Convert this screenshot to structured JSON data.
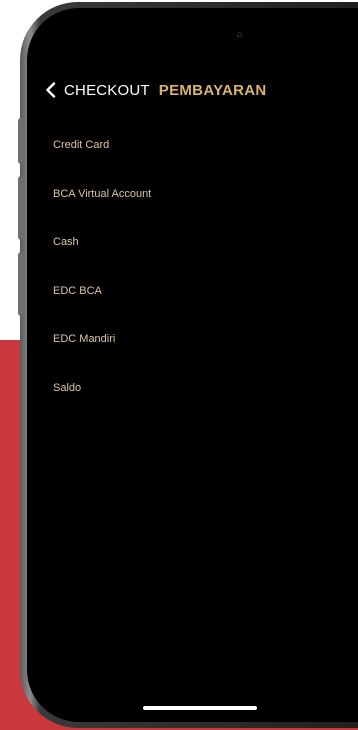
{
  "header": {
    "back_label": "CHECKOUT",
    "title": "PEMBAYARAN"
  },
  "payment_methods": [
    {
      "label": "Credit Card"
    },
    {
      "label": "BCA Virtual Account"
    },
    {
      "label": "Cash"
    },
    {
      "label": "EDC BCA"
    },
    {
      "label": "EDC Mandiri"
    },
    {
      "label": "Saldo"
    }
  ],
  "colors": {
    "accent": "#d9b26c",
    "list_text": "#d8c7a3",
    "screen_bg": "#000000",
    "backdrop_red": "#c8383d"
  },
  "icons": {
    "back": "chevron-left-icon"
  }
}
